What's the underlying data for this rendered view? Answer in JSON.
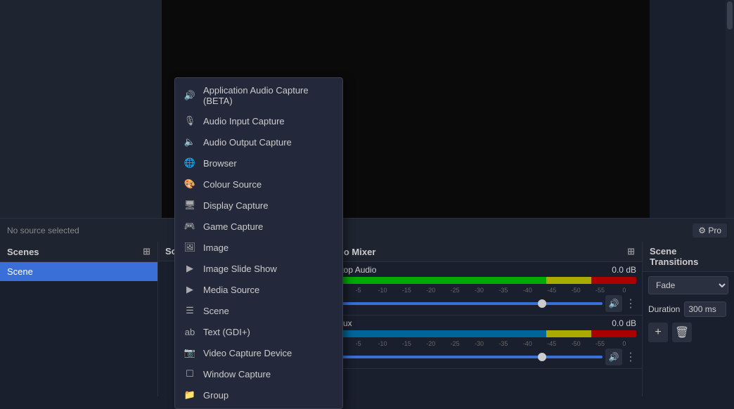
{
  "preview": {
    "bg": "#000000"
  },
  "source_bar": {
    "no_source_text": "No source selected",
    "gear_label": "⚙ Pro"
  },
  "panels": {
    "scenes": {
      "title": "Scenes",
      "items": [
        {
          "label": "Scene"
        }
      ]
    },
    "sources": {
      "title": "So"
    },
    "audio_mixer": {
      "title": "Audio Mixer",
      "channels": [
        {
          "name": "Desktop Audio",
          "db": "0.0 dB",
          "meter_labels": [
            "-0",
            "-5",
            "-10",
            "-15",
            "-20",
            "-25",
            "-30",
            "-35",
            "-40",
            "-45",
            "-50",
            "-55",
            "-0"
          ]
        },
        {
          "name": "Mic/Aux",
          "db": "0.0 dB",
          "meter_labels": [
            "-0",
            "-5",
            "-10",
            "-15",
            "-20",
            "-25",
            "-30",
            "-35",
            "-40",
            "-45",
            "-50",
            "-55",
            "-0"
          ]
        }
      ]
    },
    "scene_transitions": {
      "title": "Scene Transitions",
      "fade_label": "Fade",
      "duration_label": "Duration",
      "duration_value": "300 ms"
    }
  },
  "dropdown": {
    "items": [
      {
        "id": "app-audio",
        "icon": "🔊",
        "label": "Application Audio Capture (BETA)"
      },
      {
        "id": "audio-input",
        "icon": "🎙",
        "label": "Audio Input Capture"
      },
      {
        "id": "audio-output",
        "icon": "🔈",
        "label": "Audio Output Capture"
      },
      {
        "id": "browser",
        "icon": "🌐",
        "label": "Browser"
      },
      {
        "id": "colour-source",
        "icon": "🎨",
        "label": "Colour Source"
      },
      {
        "id": "display-capture",
        "icon": "🖥",
        "label": "Display Capture"
      },
      {
        "id": "game-capture",
        "icon": "🎮",
        "label": "Game Capture"
      },
      {
        "id": "image",
        "icon": "🖼",
        "label": "Image"
      },
      {
        "id": "image-slide-show",
        "icon": "▶",
        "label": "Image Slide Show"
      },
      {
        "id": "media-source",
        "icon": "▶",
        "label": "Media Source"
      },
      {
        "id": "scene",
        "icon": "≡",
        "label": "Scene"
      },
      {
        "id": "text-gdi",
        "icon": "ab",
        "label": "Text (GDI+)"
      },
      {
        "id": "video-capture",
        "icon": "📷",
        "label": "Video Capture Device"
      },
      {
        "id": "window-capture",
        "icon": "🪟",
        "label": "Window Capture"
      },
      {
        "id": "group",
        "icon": "📁",
        "label": "Group"
      }
    ]
  }
}
